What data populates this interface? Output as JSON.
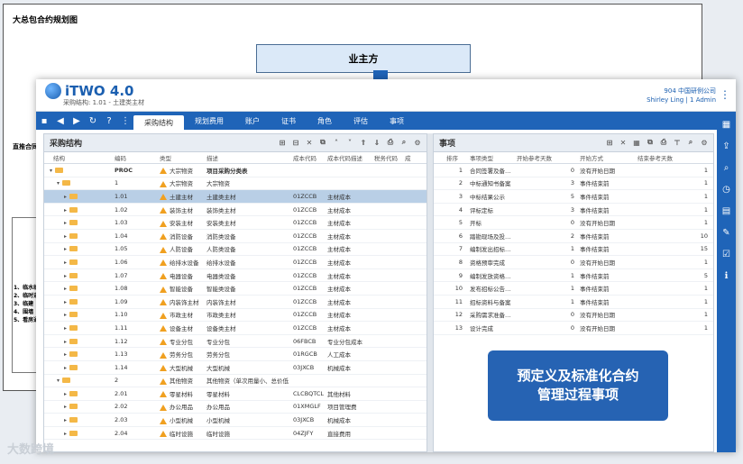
{
  "doc": {
    "title": "大总包合约规划图",
    "owner": "业主方",
    "left_label": "直推合同",
    "list": [
      "1、临水临",
      "2、临时道",
      "3、临建",
      "4、围墙",
      "5、看房通"
    ]
  },
  "app": {
    "logo_text": "iTWO 4.0",
    "subtitle": "采购结构: 1.01 - 土建类主材",
    "company": "904 中国研例公司",
    "user": "Shirley Ling | 1 Admin",
    "tabs": [
      "采购结构",
      "规划费用",
      "账户",
      "证书",
      "角色",
      "评估",
      "事项"
    ]
  },
  "left_panel": {
    "title": "采购结构",
    "columns": [
      "结构",
      "编码",
      "类型",
      "描述",
      "成本代码",
      "成本代码描述",
      "税务代码",
      "成"
    ],
    "rows": [
      {
        "code": "PROC",
        "type": "大宗物资",
        "desc": "项目采购分类表",
        "cc": "",
        "ccd": "",
        "level": 0,
        "bold": true
      },
      {
        "code": "1",
        "type": "大宗物资",
        "desc": "大宗物资",
        "cc": "",
        "ccd": "",
        "level": 1
      },
      {
        "code": "1.01",
        "type": "土建主材",
        "desc": "土建类主材",
        "cc": "01ZCCB",
        "ccd": "主材成本",
        "level": 2,
        "selected": true
      },
      {
        "code": "1.02",
        "type": "装饰主材",
        "desc": "装饰类主材",
        "cc": "01ZCCB",
        "ccd": "主材成本",
        "level": 2
      },
      {
        "code": "1.03",
        "type": "安装主材",
        "desc": "安装类主材",
        "cc": "01ZCCB",
        "ccd": "主材成本",
        "level": 2
      },
      {
        "code": "1.04",
        "type": "消防设备",
        "desc": "消防类设备",
        "cc": "01ZCCB",
        "ccd": "主材成本",
        "level": 2
      },
      {
        "code": "1.05",
        "type": "人防设备",
        "desc": "人防类设备",
        "cc": "01ZCCB",
        "ccd": "主材成本",
        "level": 2
      },
      {
        "code": "1.06",
        "type": "给排水设备",
        "desc": "给排水设备",
        "cc": "01ZCCB",
        "ccd": "主材成本",
        "level": 2
      },
      {
        "code": "1.07",
        "type": "电器设备",
        "desc": "电器类设备",
        "cc": "01ZCCB",
        "ccd": "主材成本",
        "level": 2
      },
      {
        "code": "1.08",
        "type": "智能设备",
        "desc": "智能类设备",
        "cc": "01ZCCB",
        "ccd": "主材成本",
        "level": 2
      },
      {
        "code": "1.09",
        "type": "内装饰主材",
        "desc": "内装饰主材",
        "cc": "01ZCCB",
        "ccd": "主材成本",
        "level": 2
      },
      {
        "code": "1.10",
        "type": "市政主材",
        "desc": "市政类主材",
        "cc": "01ZCCB",
        "ccd": "主材成本",
        "level": 2
      },
      {
        "code": "1.11",
        "type": "设备主材",
        "desc": "设备类主材",
        "cc": "01ZCCB",
        "ccd": "主材成本",
        "level": 2
      },
      {
        "code": "1.12",
        "type": "专业分包",
        "desc": "专业分包",
        "cc": "06FBCB",
        "ccd": "专业分包成本",
        "level": 2
      },
      {
        "code": "1.13",
        "type": "劳务分包",
        "desc": "劳务分包",
        "cc": "01RGCB",
        "ccd": "人工成本",
        "level": 2
      },
      {
        "code": "1.14",
        "type": "大型机械",
        "desc": "大型机械",
        "cc": "03JXCB",
        "ccd": "机械成本",
        "level": 2
      },
      {
        "code": "2",
        "type": "其他物资",
        "desc": "其他物资（单次用量小、总价低",
        "cc": "",
        "ccd": "",
        "level": 1
      },
      {
        "code": "2.01",
        "type": "零星材料",
        "desc": "零星材料",
        "cc": "CLCBQTCL",
        "ccd": "其他材料",
        "level": 2
      },
      {
        "code": "2.02",
        "type": "办公用品",
        "desc": "办公用品",
        "cc": "01XMGLF",
        "ccd": "项目管理费",
        "level": 2
      },
      {
        "code": "2.03",
        "type": "小型机械",
        "desc": "小型机械",
        "cc": "03JXCB",
        "ccd": "机械成本",
        "level": 2
      },
      {
        "code": "2.04",
        "type": "临时设施",
        "desc": "临时设施",
        "cc": "04ZJFY",
        "ccd": "直接费用",
        "level": 2
      }
    ]
  },
  "right_panel": {
    "title": "事项",
    "columns": [
      "排序",
      "事项类型",
      "开始参考天数",
      "开始方式",
      "结束参考天数",
      ""
    ],
    "rows": [
      {
        "n": "1",
        "type": "合同签署及备…",
        "start": "0",
        "mode": "没有开始日期",
        "end": "1"
      },
      {
        "n": "2",
        "type": "中标通知书备案",
        "start": "3",
        "mode": "事件结束前",
        "end": "1"
      },
      {
        "n": "3",
        "type": "中标结果公示",
        "start": "5",
        "mode": "事件结束前",
        "end": "1"
      },
      {
        "n": "4",
        "type": "评标定标",
        "start": "3",
        "mode": "事件结束前",
        "end": "1"
      },
      {
        "n": "5",
        "type": "开标",
        "start": "0",
        "mode": "没有开始日期",
        "end": "1"
      },
      {
        "n": "6",
        "type": "踏勘现场及投…",
        "start": "2",
        "mode": "事件结束前",
        "end": "10"
      },
      {
        "n": "7",
        "type": "编制发出招标…",
        "start": "1",
        "mode": "事件结束前",
        "end": "15"
      },
      {
        "n": "8",
        "type": "资格预审完成",
        "start": "0",
        "mode": "没有开始日期",
        "end": "1"
      },
      {
        "n": "9",
        "type": "编制发放资格…",
        "start": "1",
        "mode": "事件结束前",
        "end": "5"
      },
      {
        "n": "10",
        "type": "发布招标公告…",
        "start": "1",
        "mode": "事件结束前",
        "end": "1"
      },
      {
        "n": "11",
        "type": "招标资料与备案",
        "start": "1",
        "mode": "事件结束前",
        "end": "1"
      },
      {
        "n": "12",
        "type": "采购需求准备…",
        "start": "0",
        "mode": "没有开始日期",
        "end": "1"
      },
      {
        "n": "13",
        "type": "设计完成",
        "start": "0",
        "mode": "没有开始日期",
        "end": "1"
      }
    ]
  },
  "callout": {
    "line1": "预定义及标准化合约",
    "line2": "管理过程事项"
  },
  "watermark": "大数跨境"
}
